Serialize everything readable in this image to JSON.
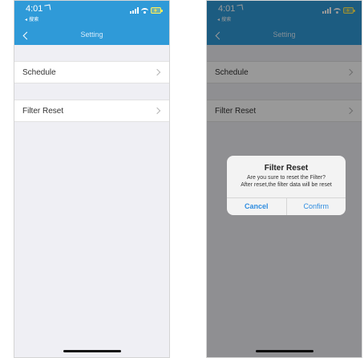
{
  "screens": [
    {
      "status": {
        "time": "4:01",
        "back_app": "◂ 搜索"
      },
      "nav": {
        "title": "Setting"
      },
      "rows": [
        {
          "label": "Schedule"
        },
        {
          "label": "Filter Reset"
        }
      ]
    },
    {
      "status": {
        "time": "4:01",
        "back_app": "◂ 搜索"
      },
      "nav": {
        "title": "Setting"
      },
      "rows": [
        {
          "label": "Schedule"
        },
        {
          "label": "Filter Reset"
        }
      ],
      "dialog": {
        "title": "Filter Reset",
        "line1": "Are you sure to reset the Filter?",
        "line2": "After reset,the filter data will be reset",
        "cancel_label": "Cancel",
        "confirm_label": "Confirm"
      }
    }
  ],
  "colors": {
    "header_blue": "#2f9ad8",
    "background": "#efeff4",
    "dialog_button": "#2f8de0"
  },
  "icons": {
    "back": "chevron-left-icon",
    "row_arrow": "chevron-right-icon",
    "signal": "cellular-signal-icon",
    "wifi": "wifi-icon",
    "battery": "battery-charging-icon",
    "location": "location-arrow-icon"
  }
}
